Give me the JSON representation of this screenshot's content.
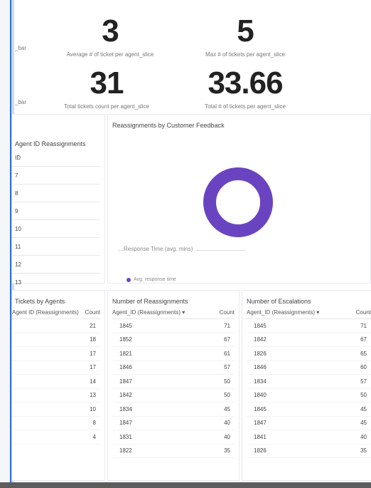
{
  "kpis": [
    {
      "value": "3",
      "label": "Average # of ticket per agent_slice",
      "side": "_bar"
    },
    {
      "value": "5",
      "label": "Max # of tickets per agent_slice",
      "side": ""
    },
    {
      "value": "31",
      "label": "Total tickets count per agent_slice",
      "side": "_bar"
    },
    {
      "value": "33.66",
      "label": "Total # of tickets per agent_slice",
      "side": ""
    }
  ],
  "left_panel": {
    "title": "Agent ID Reassignments",
    "rows": [
      "ID",
      "7",
      "8",
      "9",
      "10",
      "11",
      "12",
      "13"
    ]
  },
  "donut_panel": {
    "title": "Reassignments by Customer Feedback",
    "axis_label": "Response Time (avg. mins)",
    "legend_label": "Avg. response time",
    "accent": "#6a44c0"
  },
  "tables": [
    {
      "title": "Tickets by Agents",
      "headers": [
        "Agent ID (Reassignments)",
        "Count"
      ],
      "rows": [
        [
          "",
          "21"
        ],
        [
          "",
          "18"
        ],
        [
          "",
          "17"
        ],
        [
          "",
          "17"
        ],
        [
          "",
          "14"
        ],
        [
          "",
          "13"
        ],
        [
          "",
          "10"
        ],
        [
          "",
          "8"
        ],
        [
          "",
          "4"
        ]
      ]
    },
    {
      "title": "Number of Reassignments",
      "headers": [
        "Agent_ID (Reassignments) ▾",
        "Count"
      ],
      "rows": [
        [
          "1845",
          "71"
        ],
        [
          "1852",
          "67"
        ],
        [
          "1821",
          "61"
        ],
        [
          "1846",
          "57"
        ],
        [
          "1847",
          "50"
        ],
        [
          "1842",
          "50"
        ],
        [
          "1834",
          "45"
        ],
        [
          "1847",
          "40"
        ],
        [
          "1831",
          "40"
        ],
        [
          "1822",
          "35"
        ]
      ]
    },
    {
      "title": "Number of Escalations",
      "headers": [
        "Agent_ID (Reassignments) ▾",
        "Count"
      ],
      "rows": [
        [
          "1845",
          "71"
        ],
        [
          "1842",
          "67"
        ],
        [
          "1826",
          "65"
        ],
        [
          "1846",
          "60"
        ],
        [
          "1834",
          "57"
        ],
        [
          "1840",
          "50"
        ],
        [
          "1845",
          "45"
        ],
        [
          "1847",
          "45"
        ],
        [
          "1841",
          "40"
        ],
        [
          "1826",
          "35"
        ]
      ]
    }
  ]
}
